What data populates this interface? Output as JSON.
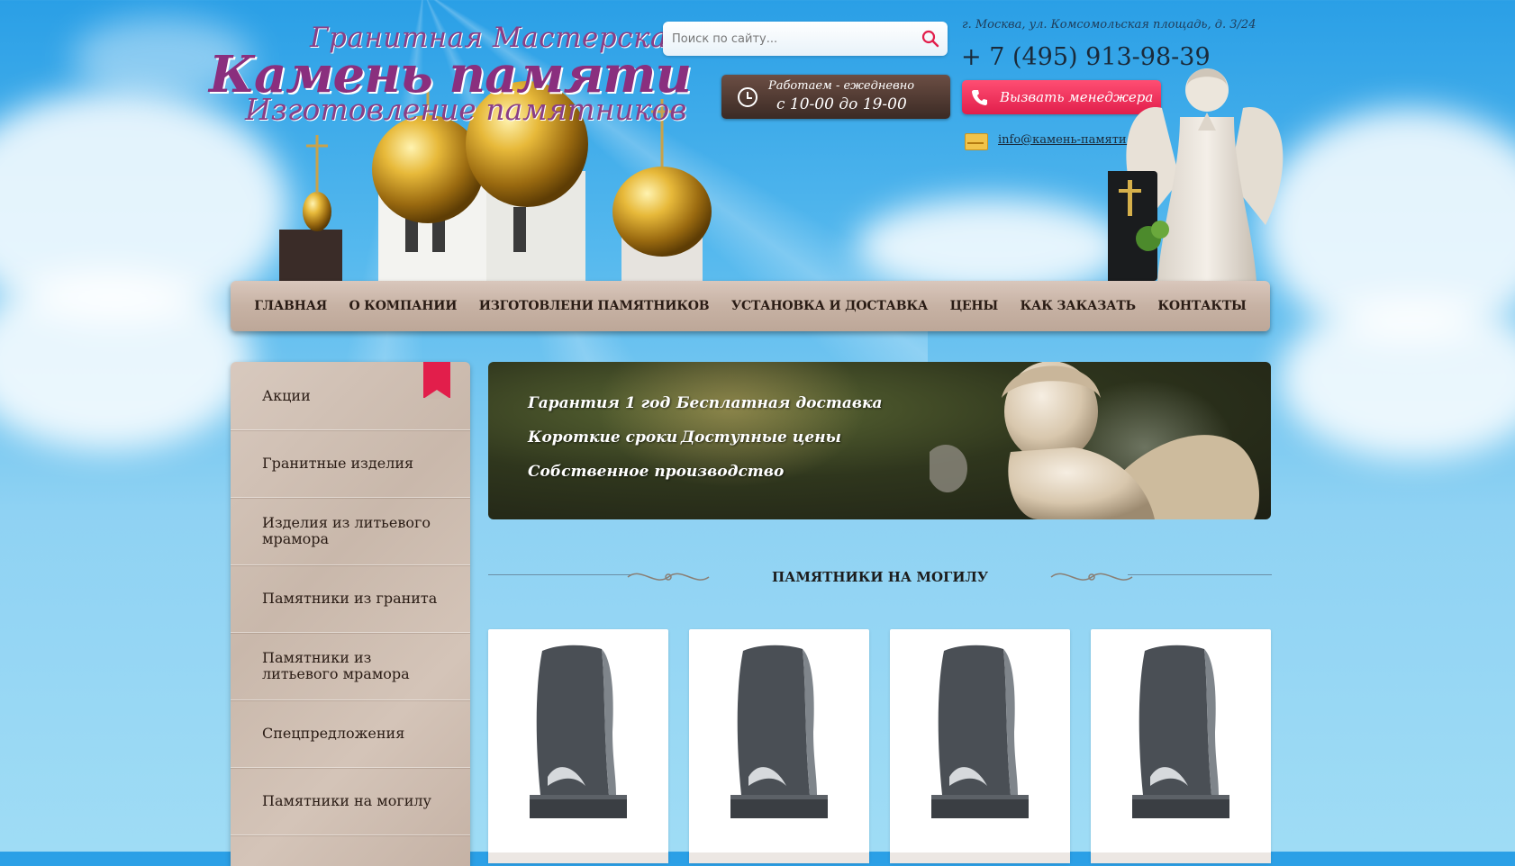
{
  "logo": {
    "line1": "Гранитная Мастерская",
    "line2": "Камень памяти",
    "line3": "Изготовление памятников"
  },
  "search": {
    "placeholder": "Поиск по сайту..."
  },
  "hours": {
    "line1": "Работаем - ежедневно",
    "line2": "с 10-00 до 19-00"
  },
  "contacts": {
    "address": "г. Москва, ул. Комсомольская площадь, д. 3/24",
    "phone": "+ 7 (495) 913-98-39",
    "call_button": "Вызвать менеджера",
    "email": "info@камень-памяти.рф"
  },
  "nav": [
    "ГЛАВНАЯ",
    "О КОМПАНИИ",
    "ИЗГОТОВЛЕНИ ПАМЯТНИКОВ",
    "УСТАНОВКА И ДОСТАВКА",
    "ЦЕНЫ",
    "КАК ЗАКАЗАТЬ",
    "КОНТАКТЫ"
  ],
  "sidebar": [
    "Акции",
    "Гранитные изделия",
    "Изделия из литьевого мрамора",
    "Памятники из гранита",
    "Памятники из литьевого мрамора",
    "Спецпредложения",
    "Памятники на могилу"
  ],
  "banner": {
    "features": [
      "Гарантия 1 год",
      "Бесплатная доставка",
      "Короткие сроки",
      "Доступные цены",
      "Собственное производство"
    ]
  },
  "section": {
    "title": "ПАМЯТНИКИ НА МОГИЛУ"
  },
  "icons": {
    "search": "search-icon",
    "clock": "clock-icon",
    "phone": "phone-icon",
    "mail": "mail-icon",
    "ribbon": "bookmark-ribbon-icon"
  },
  "colors": {
    "accent": "#e21e4b",
    "logo": "#8a2f7e",
    "hours_bg": "#4e3a33",
    "nav_bg": "#c9b4a6"
  }
}
